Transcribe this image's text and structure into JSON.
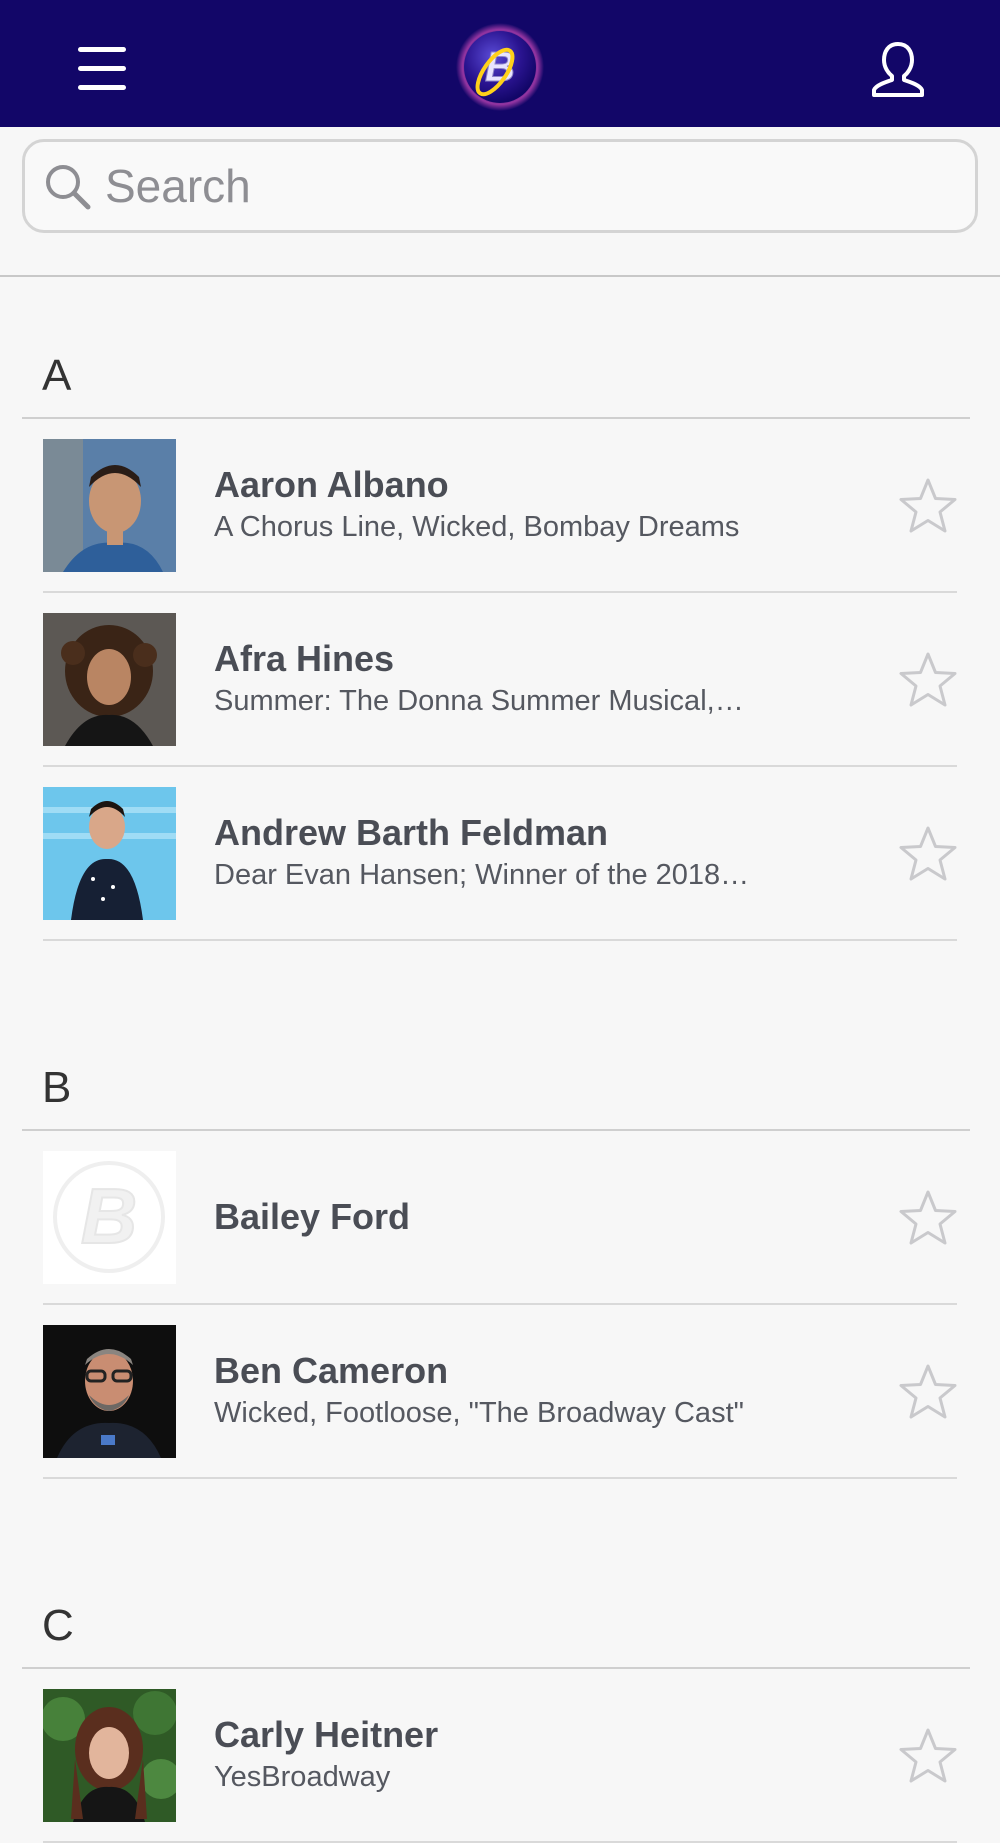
{
  "header": {
    "menu_icon": "hamburger-menu-icon",
    "logo_letter": "B",
    "logo_icon": "broadway-logo",
    "profile_icon": "user-profile-icon"
  },
  "search": {
    "placeholder": "Search",
    "value": "",
    "icon": "search-icon"
  },
  "sections": [
    {
      "letter": "A",
      "people": [
        {
          "name": "Aaron Albano",
          "credits": "A Chorus Line, Wicked, Bombay Dreams",
          "favorite": false
        },
        {
          "name": "Afra Hines",
          "credits": "Summer: The Donna Summer Musical,…",
          "favorite": false
        },
        {
          "name": "Andrew Barth Feldman",
          "credits": "Dear Evan Hansen; Winner of the 2018…",
          "favorite": false
        }
      ]
    },
    {
      "letter": "B",
      "people": [
        {
          "name": "Bailey Ford",
          "credits": "",
          "favorite": false
        },
        {
          "name": "Ben Cameron",
          "credits": "Wicked, Footloose, \"The Broadway Cast\"",
          "favorite": false
        }
      ]
    },
    {
      "letter": "C",
      "people": [
        {
          "name": "Carly Heitner",
          "credits": "YesBroadway",
          "favorite": false
        }
      ]
    }
  ],
  "colors": {
    "header_bg": "#120668",
    "star_outline": "#c9c9cc",
    "name_text": "#4a4d55"
  }
}
